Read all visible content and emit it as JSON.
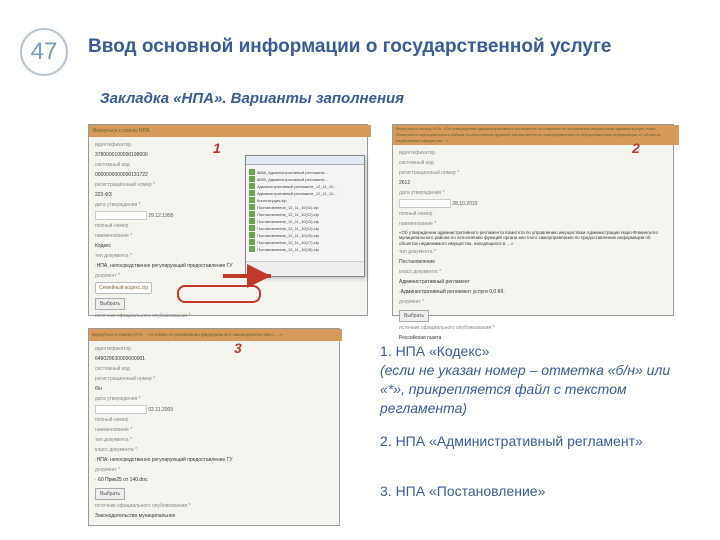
{
  "slide_number": "47",
  "title": "Ввод основной информации о государственной услуге",
  "subtitle": "Закладка «НПА». Варианты заполнения",
  "badges": {
    "n1": "1",
    "n2": "2",
    "n3": "3"
  },
  "shot1": {
    "bar": "Вернуться к списку НПА",
    "rows": [
      "идентификатор",
      "3780000100000198000",
      "системный код",
      "0000000000000131722",
      "регистрационный номер *",
      "223-ФЗ",
      "дата утверждения *",
      "29.12.1995",
      "полный номер",
      "наименование *",
      "Кодекс",
      "тип документа *",
      "·НПА, непосредственно регулирующий предоставление ГУ",
      "документ *"
    ],
    "attach": "Семейный кодекс.zip",
    "btn": "Выбрать",
    "foot": "источник официального опубликования *"
  },
  "shot2": {
    "bar": "Вернуться к списку НПА",
    "bartail": "«Об утверждении административного регламента по Комитета по управлению имуществом администрации Наро-Фоминского муниципального района по исполнению функций органа местного самоуправления по предоставлению информации об объектах недвижимого имущества…»",
    "rows": [
      "идентификатор",
      "системный код",
      "регистрационный номер *",
      "2612",
      "дата утверждения *",
      "28.10.2010",
      "полный номер",
      "наименование *",
      "«Об утверждении административного регламента Комитета по управлению имуществом Администрации Наро-Фоминского муниципального района по исполнению функций органа местного самоуправления по предоставлению информации об объектах недвижимого имущества, находящихся в …»",
      "тип документа *",
      "Постановление",
      "класс документа *",
      "Административный регламент",
      "·Административный регламент услуги 0,0 Кб.",
      "документ *"
    ],
    "btn": "Выбрать",
    "foot1": "источник официального опубликования *",
    "foot2": "Российская газета"
  },
  "shot3": {
    "bar": "Вернуться к списку НПА",
    "bartail": "«О плане по реализации федерального законодательства о …»",
    "rows": [
      "идентификатор",
      "649029630000000001",
      "системный код",
      "регистрационный номер *",
      "б/н",
      "дата утверждения *",
      "02.11.2009",
      "полный номер",
      "наименование *",
      "тип документа *",
      "класс документа *",
      "·НПА, непосредственно регулирующий предоставление ГУ",
      "документ *",
      "· 60 Прик25 от 140.doc"
    ],
    "btn": "Выбрать",
    "foot1": "источник официального опубликования *",
    "foot2": "Законодательство муниципальное"
  },
  "notes": {
    "n1a": "1. НПА «Кодекс»",
    "n1b": "(если не указан номер – отметка «б/н» или «*», прикрепляется файл с текстом регламента)",
    "n2": "2. НПА «Административный регламент»",
    "n3": "3. НПА «Постановление»"
  }
}
